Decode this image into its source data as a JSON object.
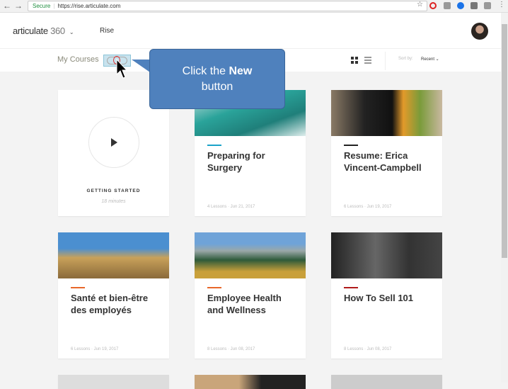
{
  "browser": {
    "secure_label": "Secure",
    "url": "https://rise.articulate.com"
  },
  "header": {
    "logo_text": "articulate",
    "logo_number": "360",
    "app_label": "Rise"
  },
  "toolbar": {
    "title": "My Courses",
    "sort_label": "Sort by:",
    "sort_value": "Recent"
  },
  "callout": {
    "text_prefix": "Click the ",
    "text_bold": "New",
    "text_suffix": "button"
  },
  "getting_started": {
    "title": "GETTING STARTED",
    "duration": "18 minutes"
  },
  "courses": [
    {
      "title": "Preparing for Surgery",
      "meta": "4 Lessons · Jun 21, 2017",
      "accent": "#1aa3c8",
      "image": "surgery"
    },
    {
      "title": "Resume: Erica Vincent-Campbell",
      "meta": "6 Lessons · Jun 19, 2017",
      "accent": "#222222",
      "image": "laptop-tulips"
    },
    {
      "title": "Santé et bien-être des employés",
      "meta": "6 Lessons · Jun 19, 2017",
      "accent": "#e8672a",
      "image": "coast"
    },
    {
      "title": "Employee Health and Wellness",
      "meta": "8 Lessons · Jun 08, 2017",
      "accent": "#e8672a",
      "image": "lake-mountains"
    },
    {
      "title": "How To Sell 101",
      "meta": "8 Lessons · Jun 08, 2017",
      "accent": "#b01a1a",
      "image": "business-meeting"
    }
  ]
}
